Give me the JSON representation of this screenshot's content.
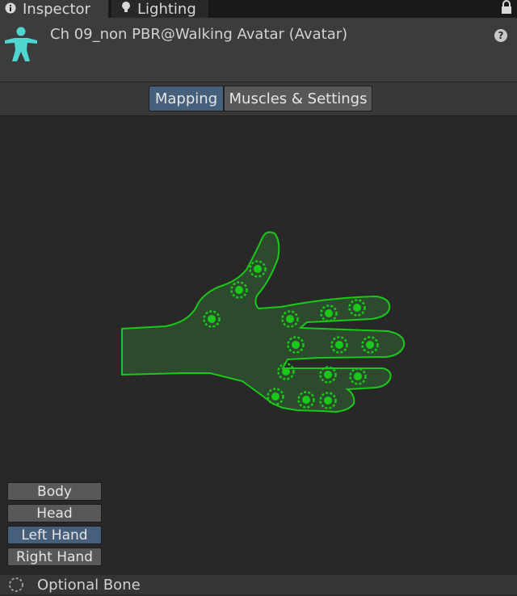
{
  "tabs": [
    {
      "label": "Inspector",
      "icon": "info-icon",
      "active": true
    },
    {
      "label": "Lighting",
      "icon": "lightbulb-icon",
      "active": false
    }
  ],
  "header": {
    "title": "Ch 09_non PBR@Walking Avatar (Avatar)",
    "icon": "humanoid-avatar-icon",
    "help_glyph": "?"
  },
  "toolbar": {
    "mapping_label": "Mapping",
    "muscles_label": "Muscles & Settings",
    "active": "Mapping"
  },
  "body_parts": {
    "body": "Body",
    "head": "Head",
    "left_hand": "Left Hand",
    "right_hand": "Right Hand",
    "selected": "Left Hand"
  },
  "footer": {
    "optional_bone_label": "Optional Bone"
  },
  "colors": {
    "accent_blue": "#46607c",
    "bone_green": "#19c819",
    "avatar_cyan": "#4fd6d0"
  }
}
